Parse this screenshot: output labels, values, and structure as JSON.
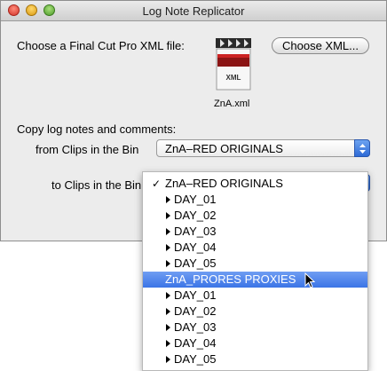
{
  "window": {
    "title": "Log Note Replicator"
  },
  "form": {
    "choose_label": "Choose a Final Cut Pro XML file:",
    "choose_button": "Choose XML...",
    "file_badge": "XML",
    "file_name": "ZnA.xml",
    "copy_label": "Copy log notes and comments:",
    "from_label": "from Clips in the Bin",
    "from_value": "ZnA–RED ORIGINALS",
    "to_label": "to Clips in the Bin"
  },
  "menu": {
    "checkmark": "✓",
    "items": [
      {
        "label": "ZnA–RED ORIGINALS"
      },
      {
        "label": "DAY_01"
      },
      {
        "label": "DAY_02"
      },
      {
        "label": "DAY_03"
      },
      {
        "label": "DAY_04"
      },
      {
        "label": "DAY_05"
      },
      {
        "label": "ZnA_PRORES PROXIES"
      },
      {
        "label": "DAY_01"
      },
      {
        "label": "DAY_02"
      },
      {
        "label": "DAY_03"
      },
      {
        "label": "DAY_04"
      },
      {
        "label": "DAY_05"
      }
    ]
  }
}
